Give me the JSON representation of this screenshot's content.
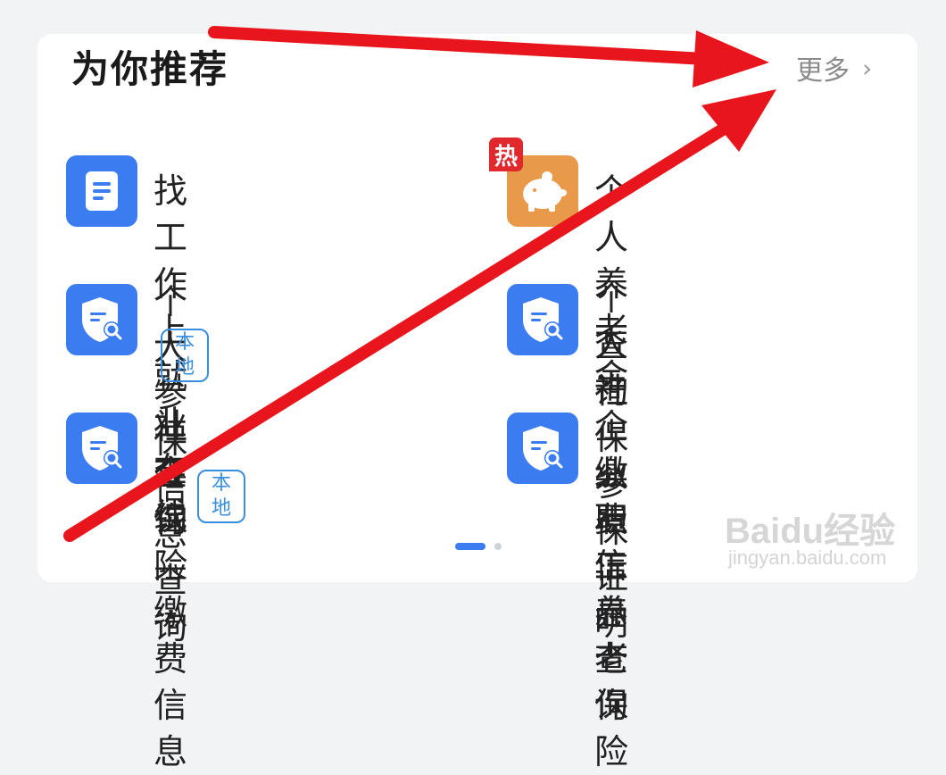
{
  "header": {
    "title": "为你推荐",
    "more_label": "更多"
  },
  "items": [
    {
      "label": "找工作上就业在线",
      "icon": "document-icon"
    },
    {
      "label": "个人养老金",
      "icon": "piggy-bank-icon",
      "hot_badge": "热"
    },
    {
      "label": "个人参保信息查询",
      "icon": "shield-search-icon",
      "tag": "本地"
    },
    {
      "label_line1": "个人社保参保证明",
      "label_line2": "查询",
      "icon": "shield-search-icon"
    },
    {
      "label_line1": "社会保险缴费信息",
      "label_line2": "查询",
      "icon": "shield-search-icon",
      "tag": "本地"
    },
    {
      "label_line1": "企业职工养老保险",
      "label_line2": "缴费信息查询",
      "icon": "shield-search-icon"
    }
  ],
  "pagination": {
    "pages": 2,
    "active": 1
  },
  "watermark": {
    "brand": "Baidu经验",
    "url": "jingyan.baidu.com"
  },
  "colors": {
    "primary": "#3b7cf0",
    "annotation_arrow": "#e8161c",
    "hot": "#e0282d",
    "tag": "#3a8ee0"
  }
}
